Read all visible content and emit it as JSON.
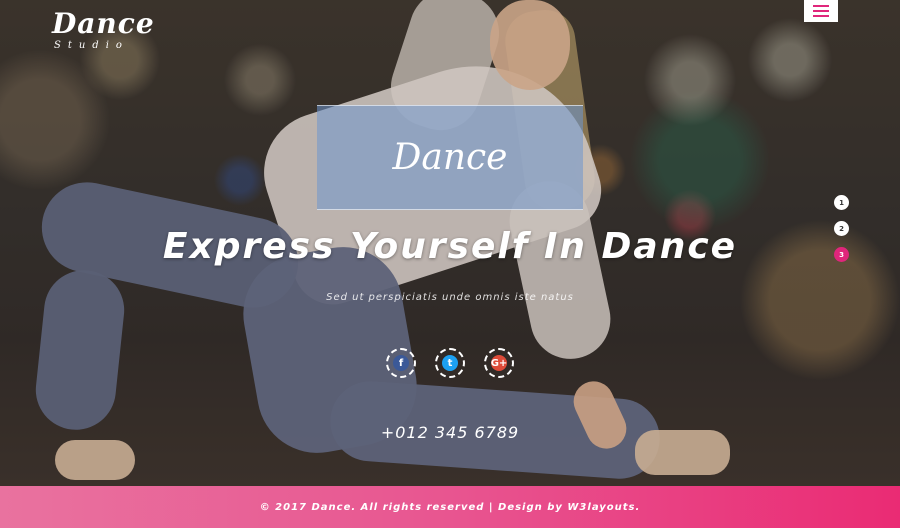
{
  "logo": {
    "title": "Dance",
    "subtitle": "Studio"
  },
  "nav": {
    "menu_icon": "hamburger-icon"
  },
  "banner": {
    "word": "Dance"
  },
  "hero": {
    "headline": "Express Yourself In Dance",
    "subline": "Sed ut perspiciatis unde omnis iste natus",
    "phone": "+012 345 6789"
  },
  "socials": [
    {
      "icon": "facebook-icon",
      "glyph": "f"
    },
    {
      "icon": "twitter-icon",
      "glyph": "t"
    },
    {
      "icon": "google-plus-icon",
      "glyph": "G+"
    }
  ],
  "slider_dots": [
    "1",
    "2",
    "3"
  ],
  "slider_active": "3",
  "footer": {
    "text": "© 2017 Dance. All rights reserved | Design by W3layouts."
  },
  "colors": {
    "accent": "#e0267b",
    "footer_start": "#e9729f",
    "footer_end": "#ea2b74"
  }
}
